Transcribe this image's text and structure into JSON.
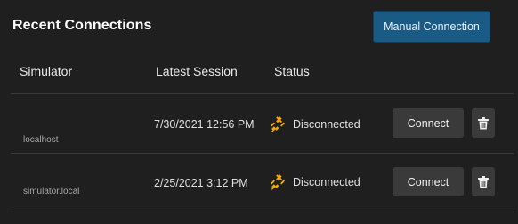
{
  "header": {
    "title": "Recent Connections",
    "manual_button": "Manual Connection"
  },
  "table": {
    "columns": [
      "Simulator",
      "Latest Session",
      "Status"
    ],
    "rows": [
      {
        "simulator": "localhost",
        "latest_session": "7/30/2021 12:56 PM",
        "status": "Disconnected",
        "connect_label": "Connect"
      },
      {
        "simulator": "simulator.local",
        "latest_session": "2/25/2021 3:12 PM",
        "status": "Disconnected",
        "connect_label": "Connect"
      }
    ]
  },
  "colors": {
    "accent": "#1a5b86",
    "status_icon": "#f2a900",
    "background": "#1f1f1f"
  },
  "icons": {
    "status": "disconnected-plug-icon",
    "delete": "trash-icon"
  }
}
